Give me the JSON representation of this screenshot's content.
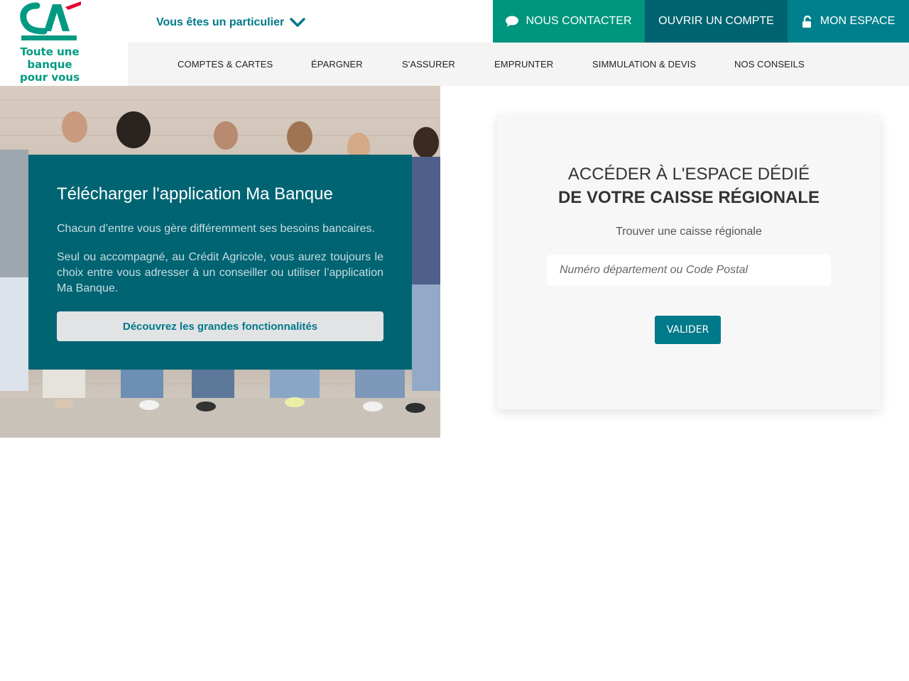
{
  "brand": {
    "logo_letters": "CA",
    "tagline_line1": "Toute une banque",
    "tagline_line2": "pour vous",
    "green": "#009a82",
    "red": "#e4002b"
  },
  "header": {
    "profile_select": "Vous êtes un particulier",
    "profile_icon": "chevron-down-icon",
    "buttons": {
      "contact": {
        "label": "NOUS CONTACTER",
        "icon": "chat-bubble-icon",
        "color": "#00957e"
      },
      "open_account": {
        "label": "OUVRIR UN COMPTE",
        "color": "#00636f"
      },
      "my_space": {
        "label": "MON ESPACE",
        "icon": "unlock-icon",
        "color": "#00808c"
      }
    }
  },
  "nav": {
    "items": [
      {
        "label": "COMPTES & CARTES"
      },
      {
        "label": "ÉPARGNER"
      },
      {
        "label": "S'ASSURER"
      },
      {
        "label": "EMPRUNTER"
      },
      {
        "label": "SIMMULATION & DEVIS"
      },
      {
        "label": "NOS CONSEILS"
      }
    ]
  },
  "promo": {
    "title": "Télécharger l'application Ma Banque",
    "paragraph1": "Chacun d’entre vous gère différemment ses besoins bancaires.",
    "paragraph2": "Seul ou accompagné, au Crédit Agricole, vous aurez toujours le choix entre vous adresser à un conseiller ou utiliser l’application Ma Banque.",
    "button": "Découvrez les grandes fonctionnalités",
    "color": "#006473"
  },
  "finder": {
    "title_line1": "ACCÉDER À L'ESPACE DÉDIÉ",
    "title_line2": "DE VOTRE CAISSE RÉGIONALE",
    "subtitle": "Trouver une caisse régionale",
    "input_placeholder": "Numéro département ou Code Postal",
    "input_value": "",
    "submit": "VALIDER",
    "accent": "#00798a"
  }
}
